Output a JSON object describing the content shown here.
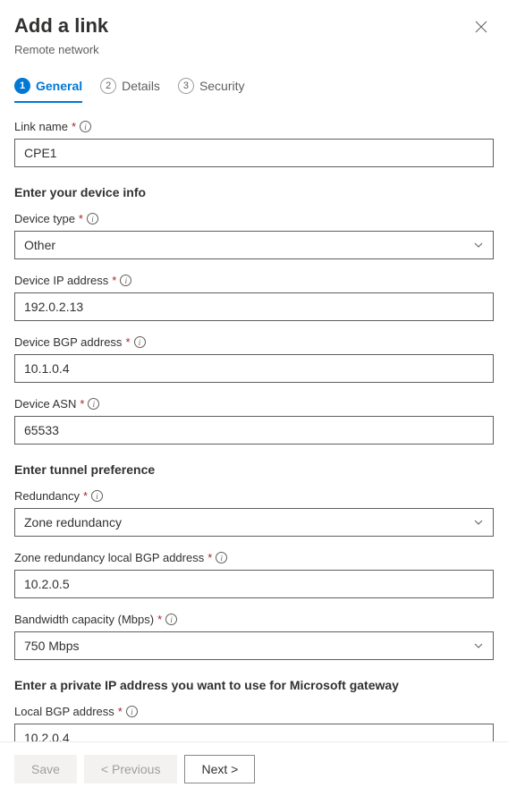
{
  "header": {
    "title": "Add a link",
    "subtitle": "Remote network"
  },
  "tabs": [
    {
      "num": "1",
      "label": "General"
    },
    {
      "num": "2",
      "label": "Details"
    },
    {
      "num": "3",
      "label": "Security"
    }
  ],
  "labels": {
    "link_name": "Link name",
    "section_device": "Enter your device info",
    "device_type": "Device type",
    "device_ip": "Device IP address",
    "device_bgp": "Device BGP address",
    "device_asn": "Device ASN",
    "section_tunnel": "Enter tunnel preference",
    "redundancy": "Redundancy",
    "zone_bgp": "Zone redundancy local BGP address",
    "bandwidth": "Bandwidth capacity (Mbps)",
    "section_private_ip": "Enter a private IP address you want to use for Microsoft gateway",
    "local_bgp": "Local BGP address"
  },
  "values": {
    "link_name": "CPE1",
    "device_type": "Other",
    "device_ip": "192.0.2.13",
    "device_bgp": "10.1.0.4",
    "device_asn": "65533",
    "redundancy": "Zone redundancy",
    "zone_bgp": "10.2.0.5",
    "bandwidth": "750 Mbps",
    "local_bgp": "10.2.0.4"
  },
  "footer": {
    "save": "Save",
    "previous": "< Previous",
    "next": "Next >"
  }
}
